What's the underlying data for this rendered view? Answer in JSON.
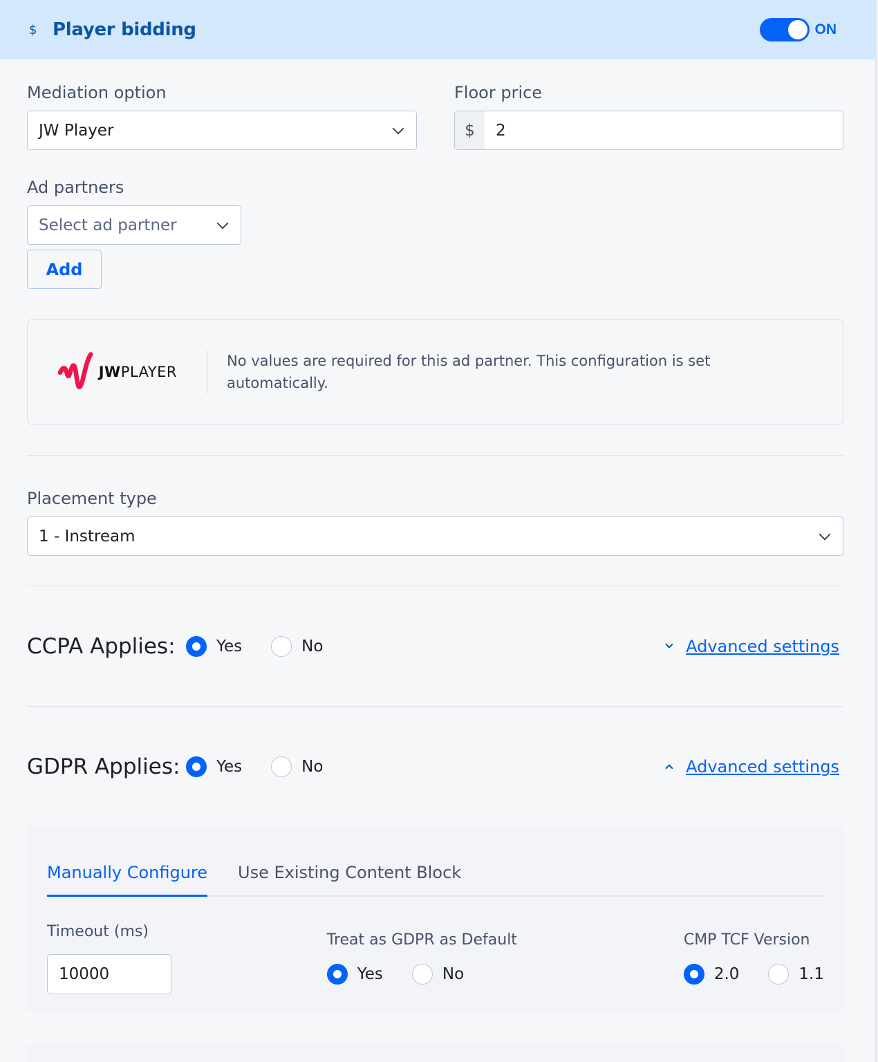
{
  "header": {
    "icon": "dollar-icon",
    "title": "Player bidding",
    "toggle_state": "ON"
  },
  "mediation": {
    "label": "Mediation option",
    "value": "JW Player"
  },
  "floor_price": {
    "label": "Floor price",
    "currency": "$",
    "value": "2"
  },
  "ad_partners": {
    "label": "Ad partners",
    "placeholder": "Select ad partner",
    "add_label": "Add"
  },
  "partner_card": {
    "logo_text_bold": "JW",
    "logo_text": "PLAYER",
    "message": "No values are required for this ad partner. This configuration is set automatically."
  },
  "placement": {
    "label": "Placement type",
    "value": "1 - Instream"
  },
  "ccpa": {
    "label": "CCPA Applies:",
    "options": [
      "Yes",
      "No"
    ],
    "selected": "Yes",
    "advanced_label": "Advanced settings",
    "advanced_expanded": false
  },
  "gdpr": {
    "label": "GDPR Applies:",
    "options": [
      "Yes",
      "No"
    ],
    "selected": "Yes",
    "advanced_label": "Advanced settings",
    "advanced_expanded": true
  },
  "advanced": {
    "tabs": [
      {
        "label": "Manually Configure",
        "active": true
      },
      {
        "label": "Use Existing Content Block",
        "active": false
      }
    ],
    "timeout": {
      "label": "Timeout (ms)",
      "value": "10000"
    },
    "gdpr_default": {
      "label": "Treat as GDPR as Default",
      "options": [
        "Yes",
        "No"
      ],
      "selected": "Yes"
    },
    "cmp_version": {
      "label": "CMP TCF Version",
      "options": [
        "2.0",
        "1.1"
      ],
      "selected": "2.0"
    }
  },
  "colors": {
    "accent": "#0562f7",
    "header_bg": "#d3e8fc",
    "header_text": "#0b56a4",
    "brand_red": "#f0144b"
  }
}
